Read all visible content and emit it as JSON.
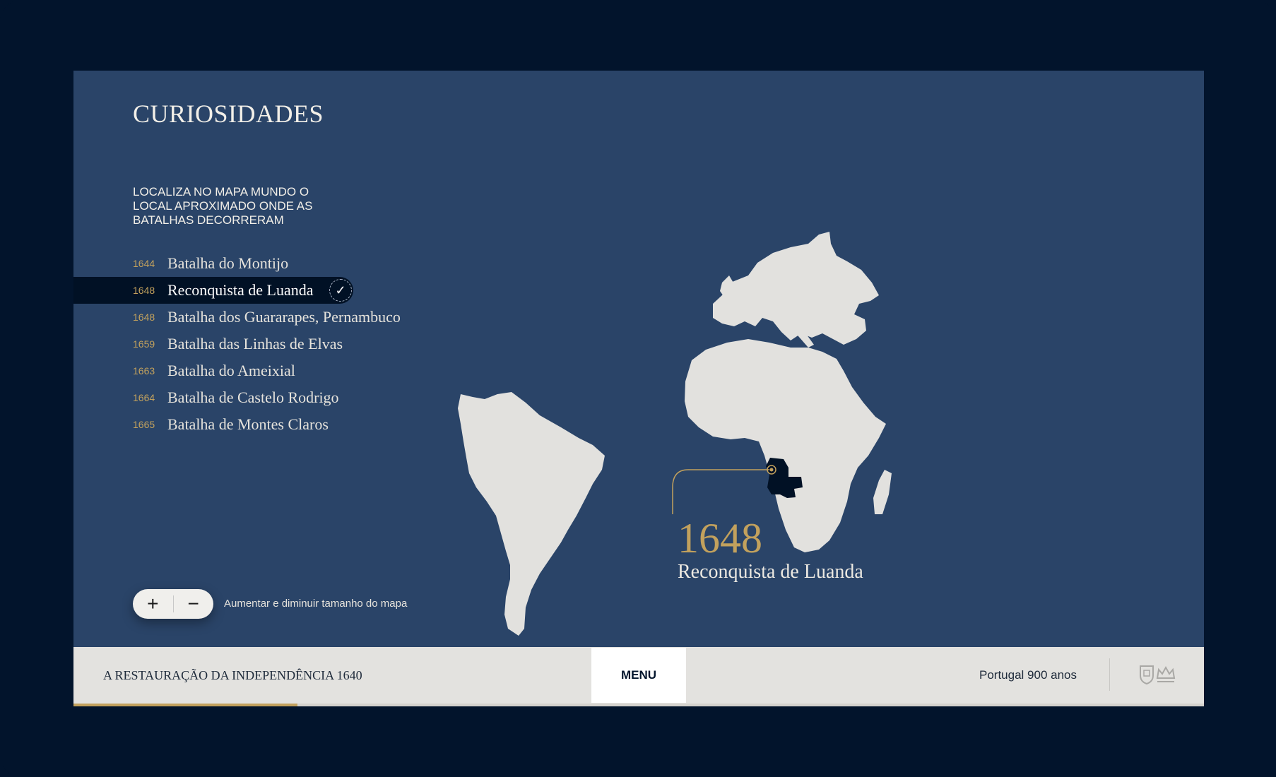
{
  "page": {
    "title": "CURIOSIDADES",
    "instruction": "LOCALIZA NO MAPA MUNDO O LOCAL APROXIMADO ONDE AS BATALHAS DECORRERAM"
  },
  "battles": [
    {
      "year": "1644",
      "name": "Batalha do Montijo",
      "active": false
    },
    {
      "year": "1648",
      "name": "Reconquista de Luanda",
      "active": true
    },
    {
      "year": "1648",
      "name": "Batalha dos Guararapes, Pernambuco",
      "active": false
    },
    {
      "year": "1659",
      "name": "Batalha das Linhas de Elvas",
      "active": false
    },
    {
      "year": "1663",
      "name": "Batalha do Ameixial",
      "active": false
    },
    {
      "year": "1664",
      "name": "Batalha de Castelo Rodrigo",
      "active": false
    },
    {
      "year": "1665",
      "name": "Batalha de Montes Claros",
      "active": false
    }
  ],
  "check_icon": "✓",
  "zoom": {
    "plus": "+",
    "minus": "−",
    "label": "Aumentar e diminuir tamanho do mapa"
  },
  "map_callout": {
    "year": "1648",
    "name": "Reconquista de Luanda"
  },
  "footer": {
    "title": "A RESTAURAÇÃO DA INDEPENDÊNCIA 1640",
    "menu_label": "MENU",
    "right_label": "Portugal 900 anos",
    "emblem_icon": "coat-of-arms-and-crown",
    "progress": 0.198
  },
  "colors": {
    "background": "#02142c",
    "map_ocean": "#2a4468",
    "land": "#e2e1de",
    "highlight_country": "#011125",
    "accent_gold": "#c2a15d",
    "footer": "#e3e2df"
  }
}
